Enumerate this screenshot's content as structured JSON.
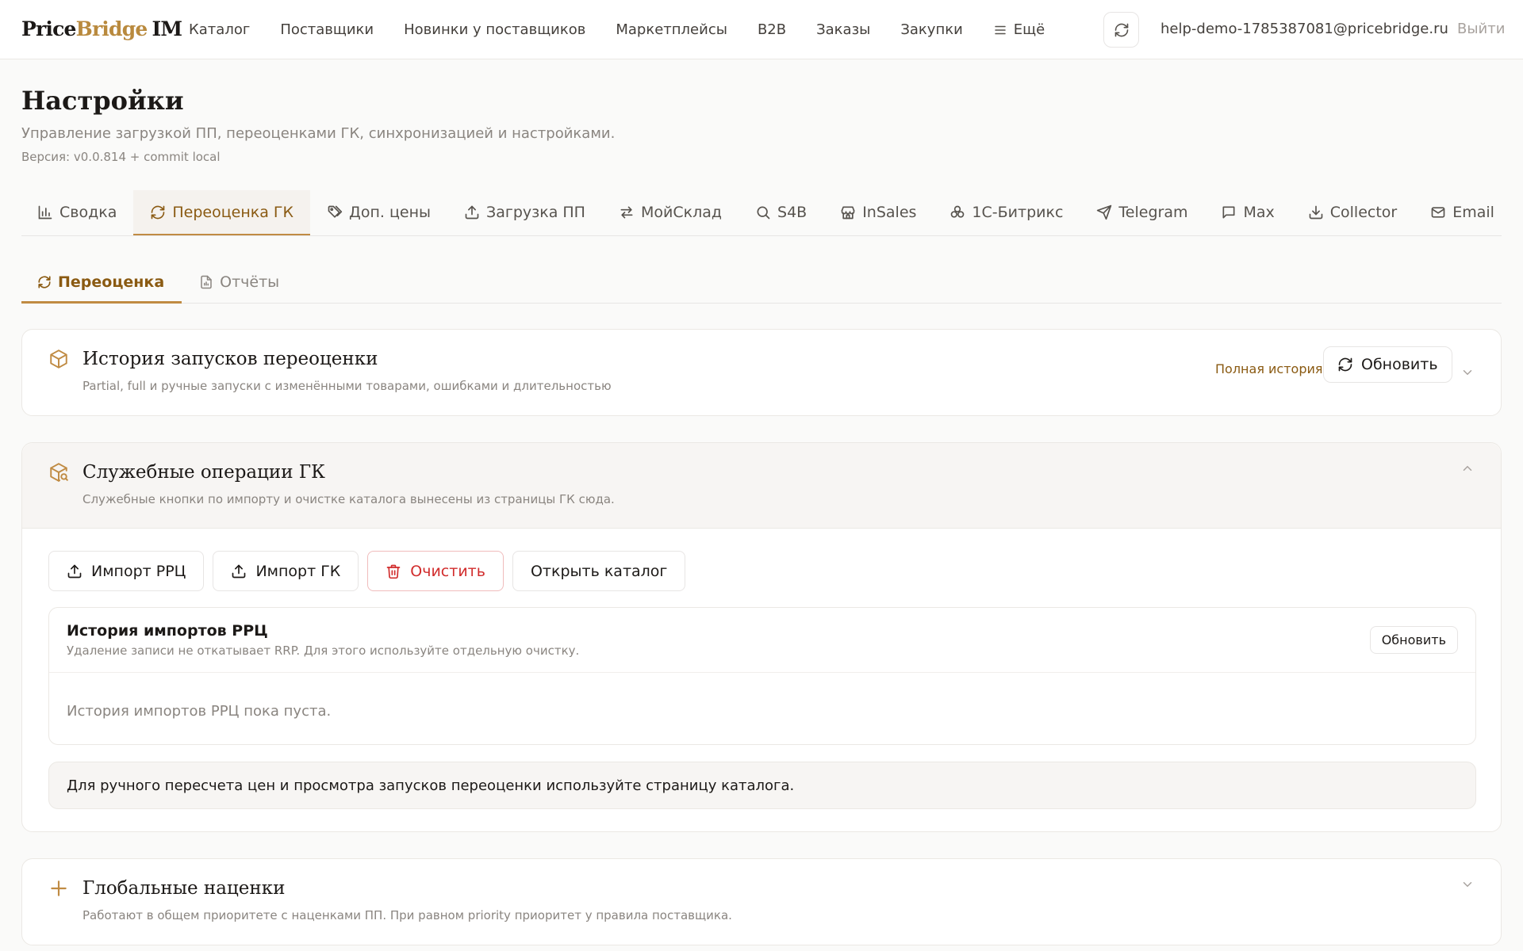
{
  "brand": {
    "part1": "Price",
    "part2": "Bridge",
    "part3": "IM"
  },
  "nav": {
    "items": [
      "Каталог",
      "Поставщики",
      "Новинки у поставщиков",
      "Маркетплейсы",
      "B2B",
      "Заказы",
      "Закупки"
    ],
    "more": "Ещё"
  },
  "user": {
    "email": "help-demo-1785387081@pricebridge.ru",
    "logout": "Выйти"
  },
  "header": {
    "title": "Настройки",
    "subtitle": "Управление загрузкой ПП, переоценками ГК, синхронизацией и настройками.",
    "version": "Версия: v0.0.814 + commit local"
  },
  "tabs": {
    "summary": "Сводка",
    "reprice": "Переоценка ГК",
    "extra_prices": "Доп. цены",
    "upload": "Загрузка ПП",
    "moysklad": "МойСклад",
    "s4b": "S4B",
    "insales": "InSales",
    "bitrix": "1С-Битрикс",
    "telegram": "Telegram",
    "max": "Max",
    "collector": "Collector",
    "email": "Email"
  },
  "subtabs": {
    "reprice": "Переоценка",
    "reports": "Отчёты"
  },
  "history_card": {
    "title": "История запусков переоценки",
    "desc": "Partial, full и ручные запуски с изменёнными товарами, ошибками и длительностью",
    "full_history": "Полная история",
    "refresh": "Обновить"
  },
  "ops_card": {
    "title": "Служебные операции ГК",
    "desc": "Служебные кнопки по импорту и очистке каталога вынесены из страницы ГК сюда.",
    "import_rrp": "Импорт РРЦ",
    "import_gk": "Импорт ГК",
    "clear": "Очистить",
    "open_catalog": "Открыть каталог",
    "rrp_history": {
      "title": "История импортов РРЦ",
      "desc": "Удаление записи не откатывает RRP. Для этого используйте отдельную очистку.",
      "refresh": "Обновить",
      "empty": "История импортов РРЦ пока пуста."
    },
    "note": "Для ручного пересчета цен и просмотра запусков переоценки используйте страницу каталога."
  },
  "markup_card": {
    "title": "Глобальные наценки",
    "desc": "Работают в общем приоритете с наценками ПП. При равном priority приоритет у правила поставщика."
  },
  "colors": {
    "accent": "#c08b43",
    "accent_text": "#8a5a12",
    "danger": "#d12c2c"
  }
}
